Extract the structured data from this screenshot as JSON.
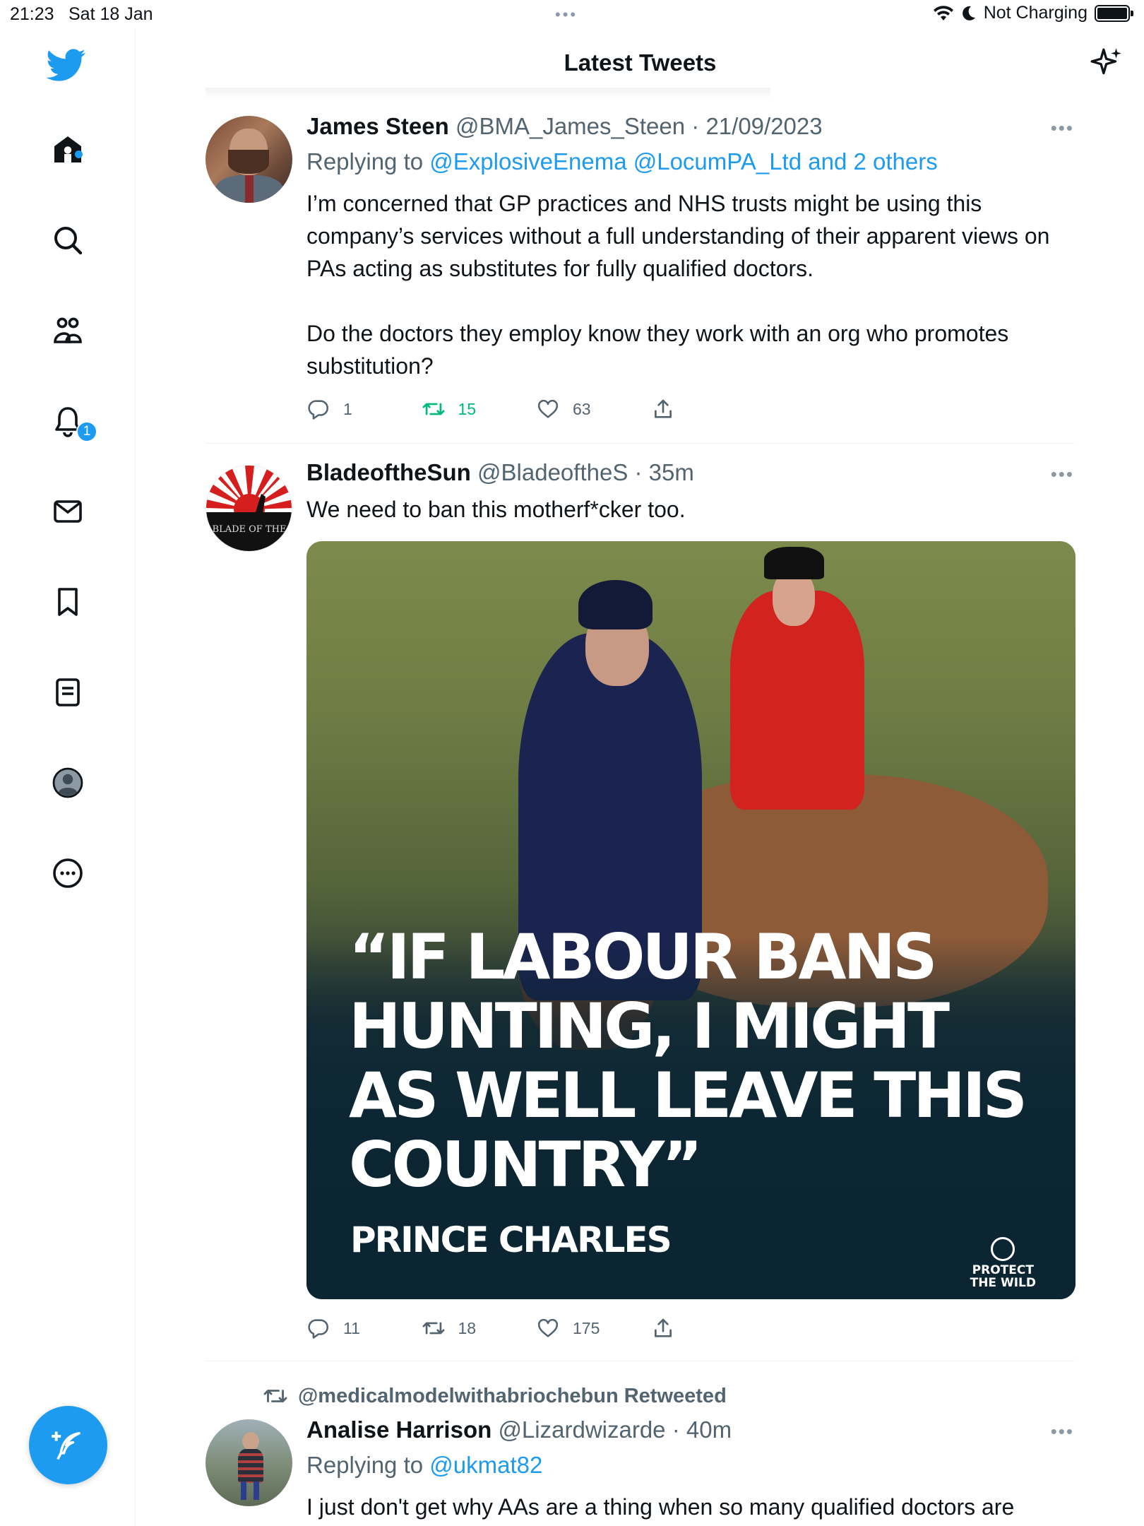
{
  "status_bar": {
    "time": "21:23",
    "date": "Sat 18 Jan",
    "dots": "•••",
    "charging": "Not Charging"
  },
  "header": {
    "title": "Latest Tweets"
  },
  "sidebar": {
    "items": [
      {
        "icon": "home-icon"
      },
      {
        "icon": "search-icon"
      },
      {
        "icon": "communities-icon"
      },
      {
        "icon": "notifications-icon",
        "badge": "1"
      },
      {
        "icon": "messages-icon"
      },
      {
        "icon": "bookmarks-icon"
      },
      {
        "icon": "lists-icon"
      },
      {
        "icon": "profile-icon"
      },
      {
        "icon": "more-icon"
      }
    ],
    "compose_icon": "compose-tweet-icon"
  },
  "tweets": [
    {
      "name": "James Steen",
      "handle": "@BMA_James_Steen",
      "separator": " · ",
      "time": "21/09/2023",
      "replying_label": "Replying to ",
      "replying_to": "@ExplosiveEnema @LocumPA_Ltd and 2 others",
      "text_p1": "I’m concerned that GP practices and NHS trusts might be using this company’s services without a full understanding of their apparent views on PAs acting as substitutes for fully qualified doctors.",
      "text_p2": "Do the doctors they employ know they work with an org who promotes substitution?",
      "replies": "1",
      "retweets": "15",
      "likes": "63"
    },
    {
      "name": "BladeoftheSun",
      "handle": "@BladeoftheS",
      "separator": " · ",
      "time": "35m",
      "text": "We need to ban this motherf*cker too.",
      "avatar_text": "BLADE OF THE",
      "media": {
        "quote": "“IF LABOUR BANS HUNTING, I MIGHT AS WELL LEAVE THIS COUNTRY”",
        "attribution": "PRINCE CHARLES",
        "logo_line1": "PROTECT",
        "logo_line2": "THE WILD"
      },
      "replies": "11",
      "retweets": "18",
      "likes": "175"
    },
    {
      "retweeted_by": "@medicalmodelwithabriochebun Retweeted",
      "name": "Analise Harrison",
      "handle": "@Lizardwizarde",
      "separator": " · ",
      "time": "40m",
      "replying_label": "Replying to ",
      "replying_to": "@ukmat82",
      "text": "I just don't get why AAs are a thing when so many qualified doctors are"
    }
  ],
  "colors": {
    "accent": "#1d9bf0",
    "retweet_green": "#00ba7c",
    "secondary_text": "#536471"
  }
}
